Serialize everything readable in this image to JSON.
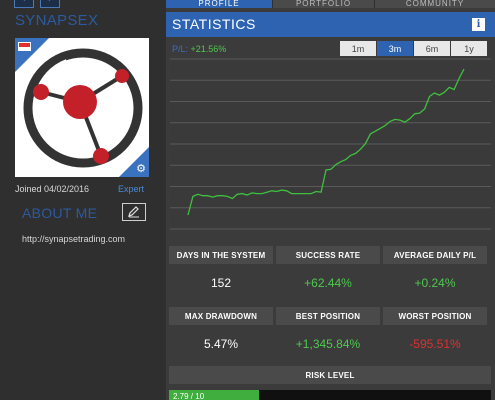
{
  "profile": {
    "username": "SYNAPSEX",
    "joined": "Joined 04/02/2016",
    "badge": "Expert",
    "about_title": "ABOUT ME",
    "website": "http://synapsetrading.com",
    "flag": "singapore-flag"
  },
  "tabs": [
    {
      "label": "PROFILE",
      "active": true
    },
    {
      "label": "PORTFOLIO",
      "active": false
    },
    {
      "label": "COMMUNITY",
      "active": false
    }
  ],
  "statistics": {
    "title": "STATISTICS",
    "pl_label": "P/L:",
    "pl_value": "+21.56%",
    "ranges": [
      {
        "label": "1m",
        "active": false
      },
      {
        "label": "3m",
        "active": true
      },
      {
        "label": "6m",
        "active": false
      },
      {
        "label": "1y",
        "active": false
      }
    ]
  },
  "chart_data": {
    "type": "line",
    "title": "",
    "xlabel": "",
    "ylabel": "",
    "series": [
      {
        "values": [
          0.5,
          3.2,
          3.5,
          3.3,
          3.3,
          3.1,
          3.3,
          3.3,
          3.2,
          2.9,
          3.5,
          3.6,
          3.4,
          3.7,
          3.6,
          3.6,
          3.8,
          4.0,
          3.9,
          4.1,
          4.0,
          3.6,
          3.6,
          3.6,
          3.6,
          3.6,
          3.9,
          3.8,
          7.0,
          7.1,
          7.8,
          8.2,
          8.5,
          9.1,
          9.4,
          10.0,
          10.8,
          12.2,
          12.6,
          13.0,
          13.4,
          14.0,
          14.3,
          14.2,
          13.9,
          14.4,
          15.1,
          15.2,
          15.8,
          17.6,
          18.1,
          17.8,
          18.2,
          18.9,
          18.6,
          20.2,
          21.56
        ]
      }
    ],
    "colors": {
      "line": "#3fbf3f",
      "grid": "#5a5a5a",
      "plot_bg": "#3a3a3a"
    },
    "grid": true,
    "legend": "none"
  },
  "stats": [
    [
      {
        "label": "DAYS IN THE SYSTEM",
        "value": "152",
        "tone": "neutral"
      },
      {
        "label": "SUCCESS RATE",
        "value": "+62.44%",
        "tone": "positive"
      },
      {
        "label": "AVERAGE DAILY P/L",
        "value": "+0.24%",
        "tone": "positive"
      }
    ],
    [
      {
        "label": "MAX DRAWDOWN",
        "value": "5.47%",
        "tone": "neutral"
      },
      {
        "label": "BEST POSITION",
        "value": "+1,345.84%",
        "tone": "positive"
      },
      {
        "label": "WORST POSITION",
        "value": "-595.51%",
        "tone": "negative"
      }
    ]
  ],
  "risk": {
    "label": "RISK LEVEL",
    "value_text": "2.79 / 10",
    "fraction": 0.279
  },
  "colors": {
    "accent": "#2d63b0",
    "positive": "#4ec94e",
    "negative": "#e03030"
  },
  "icons": {
    "nav_prev": "chevron-left-icon",
    "nav_next": "chevron-right-icon",
    "edit": "pencil-icon",
    "info": "info-icon",
    "avatar_corner": "gear-icon"
  }
}
